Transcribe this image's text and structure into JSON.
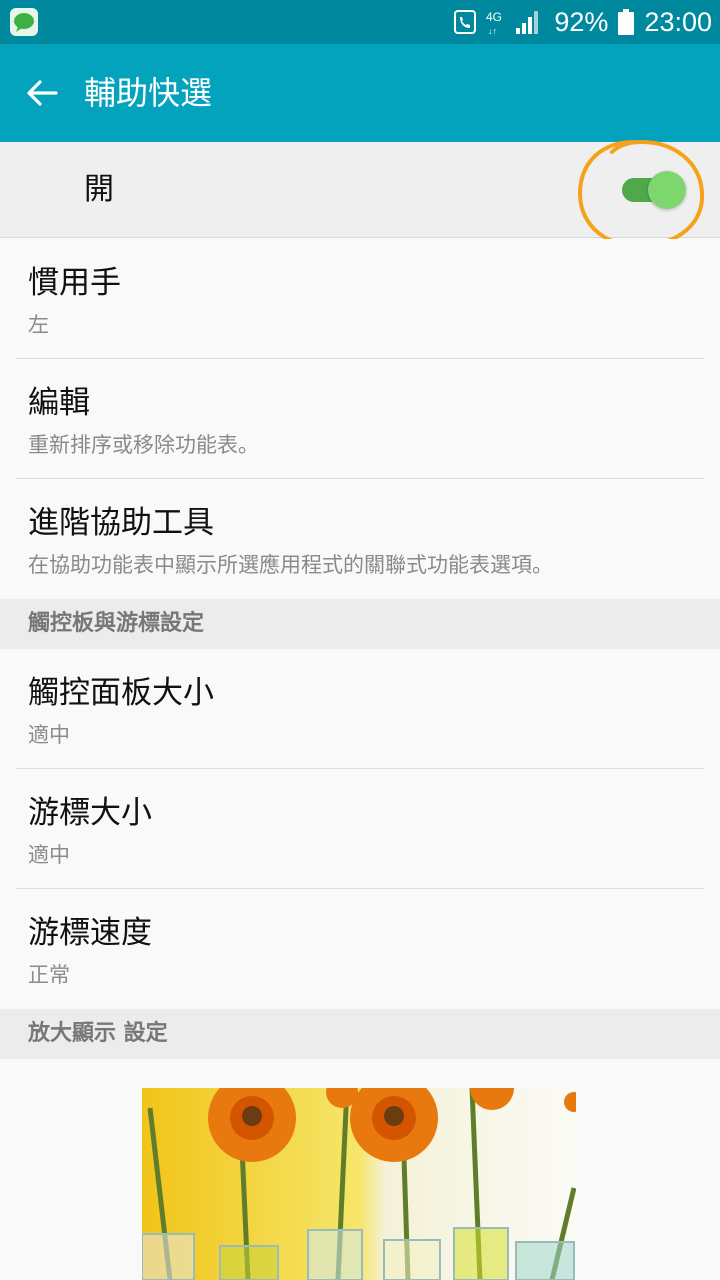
{
  "status_bar": {
    "signal_label": "4G",
    "battery_percent": "92%",
    "time": "23:00"
  },
  "app_bar": {
    "title": "輔助快選"
  },
  "master_switch": {
    "label": "開",
    "state": true
  },
  "settings": [
    {
      "primary": "慣用手",
      "secondary": "左"
    },
    {
      "primary": "編輯",
      "secondary": "重新排序或移除功能表。"
    },
    {
      "primary": "進階協助工具",
      "secondary": "在協助功能表中顯示所選應用程式的關聯式功能表選項。"
    }
  ],
  "section_touchpad": {
    "header": "觸控板與游標設定",
    "items": [
      {
        "primary": "觸控面板大小",
        "secondary": "適中"
      },
      {
        "primary": "游標大小",
        "secondary": "適中"
      },
      {
        "primary": "游標速度",
        "secondary": "正常"
      }
    ]
  },
  "section_magnify": {
    "header": "放大顯示 設定"
  },
  "colors": {
    "status_bar": "#00899e",
    "app_bar": "#03a2bd",
    "switch_on": "#7ed66f",
    "annotation": "#f5a21a"
  }
}
